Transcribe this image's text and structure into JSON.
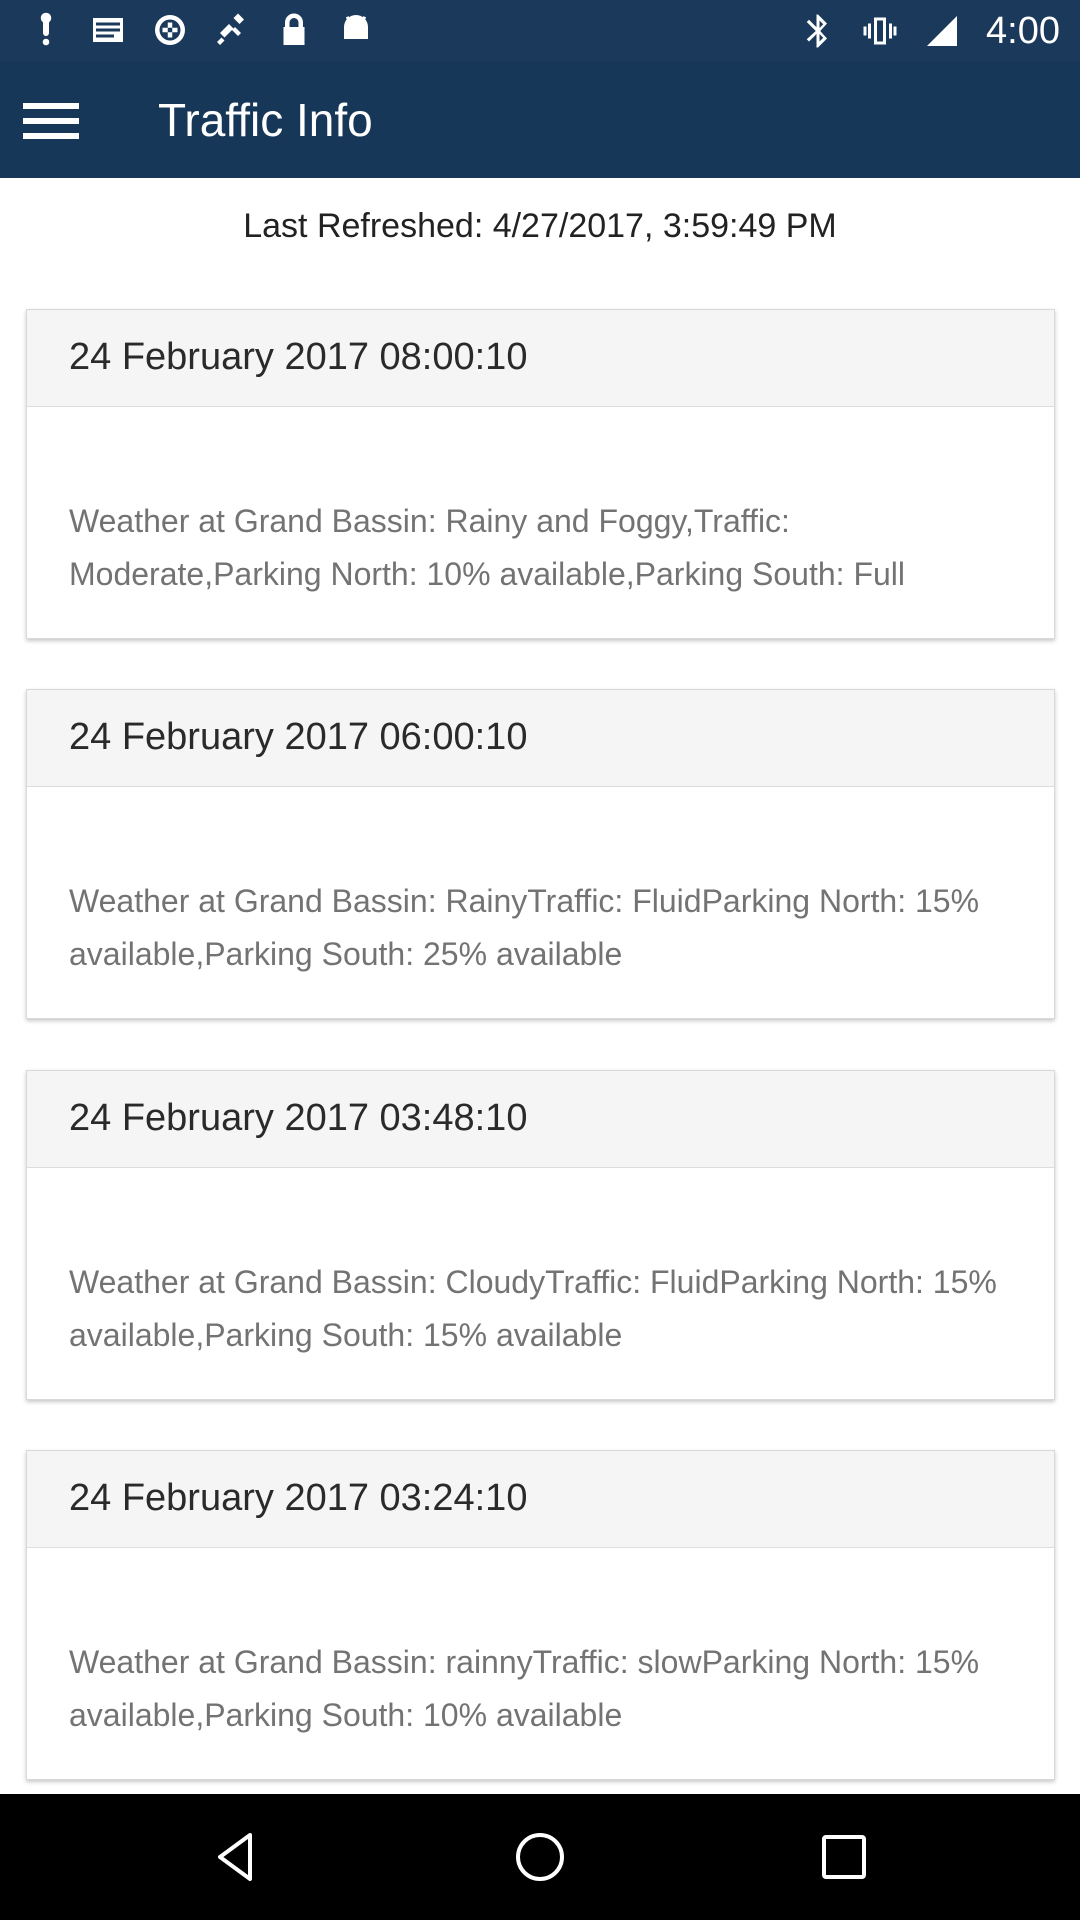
{
  "status_bar": {
    "time": "4:00",
    "left_icons": [
      "notification-icon",
      "message-icon",
      "no-disturb-icon",
      "fake-gps-icon",
      "lock-icon",
      "android-icon"
    ],
    "right_icons": [
      "bluetooth-icon",
      "vibrate-icon",
      "signal-icon"
    ]
  },
  "app_bar": {
    "title": "Traffic Info",
    "menu_icon": "hamburger-menu-icon",
    "color": "#173758"
  },
  "refresh_text": "Last Refreshed: 4/27/2017, 3:59:49 PM",
  "cards": [
    {
      "title": "24 February 2017 08:00:10",
      "body": "Weather at Grand Bassin: Rainy and Foggy,Traffic: Moderate,Parking North: 10% available,Parking South: Full"
    },
    {
      "title": "24 February 2017 06:00:10",
      "body": "Weather at Grand Bassin: RainyTraffic: FluidParking North: 15% available,Parking South: 25% available"
    },
    {
      "title": "24 February 2017 03:48:10",
      "body": "Weather at Grand Bassin: CloudyTraffic: FluidParking North: 15% available,Parking South: 15% available"
    },
    {
      "title": "24 February 2017 03:24:10",
      "body": "Weather at Grand Bassin: rainnyTraffic: slowParking North: 15% available,Parking South: 10% available"
    }
  ],
  "nav_bar": {
    "buttons": [
      "back-icon",
      "home-icon",
      "recents-icon"
    ]
  }
}
